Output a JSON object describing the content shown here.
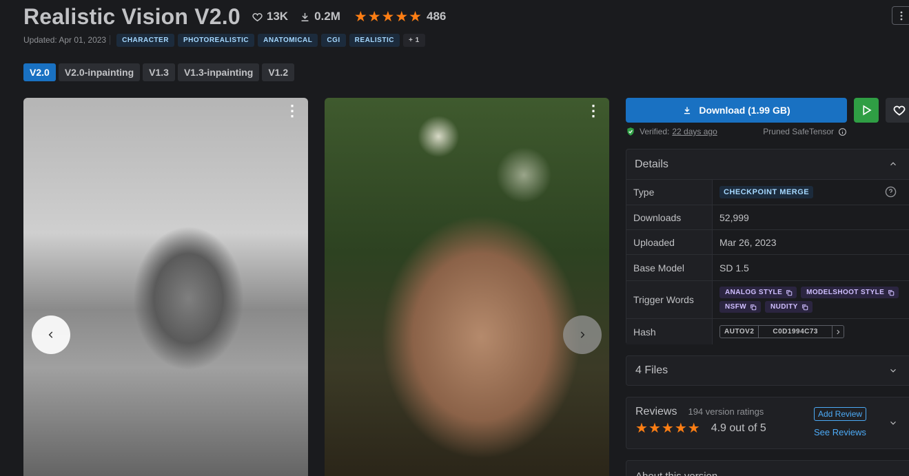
{
  "header": {
    "title": "Realistic Vision V2.0",
    "likes": "13K",
    "downloads": "0.2M",
    "rating_count": "486",
    "stars": 5,
    "updated": "Updated: Apr 01, 2023",
    "tags": [
      "CHARACTER",
      "PHOTOREALISTIC",
      "ANATOMICAL",
      "CGI",
      "REALISTIC"
    ],
    "tags_more": "+ 1"
  },
  "versions": [
    {
      "label": "V2.0",
      "active": true
    },
    {
      "label": "V2.0-inpainting",
      "active": false
    },
    {
      "label": "V1.3",
      "active": false
    },
    {
      "label": "V1.3-inpainting",
      "active": false
    },
    {
      "label": "V1.2",
      "active": false
    }
  ],
  "actions": {
    "download_label": "Download (1.99 GB)",
    "verified_label": "Verified:",
    "verified_when": "22 days ago",
    "file_format": "Pruned SafeTensor"
  },
  "details": {
    "title": "Details",
    "type_key": "Type",
    "type_value": "CHECKPOINT MERGE",
    "downloads_key": "Downloads",
    "downloads_value": "52,999",
    "uploaded_key": "Uploaded",
    "uploaded_value": "Mar 26, 2023",
    "base_model_key": "Base Model",
    "base_model_value": "SD 1.5",
    "trigger_key": "Trigger Words",
    "trigger_words": [
      "ANALOG STYLE",
      "MODELSHOOT STYLE",
      "NSFW",
      "NUDITY"
    ],
    "hash_key": "Hash",
    "hash_type": "AUTOV2",
    "hash_value": "C0D1994C73"
  },
  "files": {
    "label": "4 Files"
  },
  "reviews": {
    "title": "Reviews",
    "sub": "194 version ratings",
    "score": "4.9 out of 5",
    "stars": 5,
    "add_label": "Add Review",
    "see_label": "See Reviews"
  },
  "about": {
    "label": "About this version"
  },
  "colors": {
    "accent": "#1971c2",
    "run": "#2f9e44",
    "star": "#fd7e14",
    "background": "#1a1b1e"
  }
}
